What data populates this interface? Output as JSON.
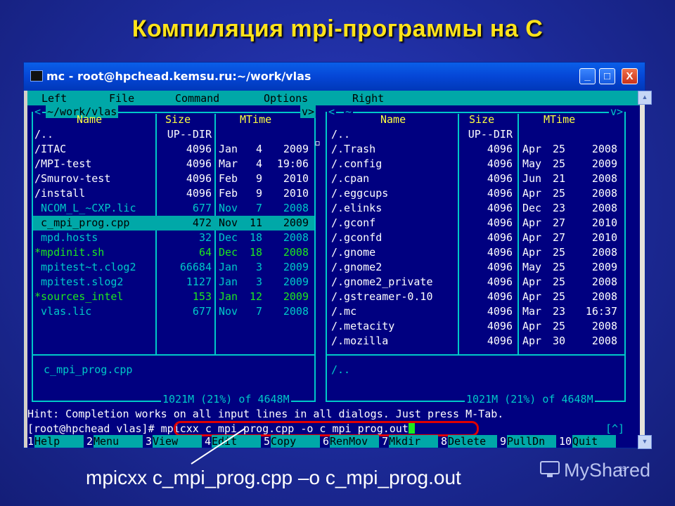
{
  "slide": {
    "title": "Компиляция mpi-программы на С",
    "caption": "mpicxx c_mpi_prog.cpp –o c_mpi_prog.out",
    "watermark": "MyShared",
    "slide_number": "25"
  },
  "window": {
    "title": "mc - root@hpchead.kemsu.ru:~/work/vlas",
    "buttons": {
      "minimize": "_",
      "maximize": "□",
      "close": "X"
    }
  },
  "menu": [
    "Left",
    "File",
    "Command",
    "Options",
    "Right"
  ],
  "left_panel": {
    "path": "~/work/vlas",
    "nav_left": "<",
    "nav_right": "v>",
    "headers": {
      "name": "Name",
      "size": "Size",
      "mtime": "MTime"
    },
    "rows": [
      {
        "name": "/..",
        "size": "UP--DIR",
        "month": "",
        "day": "",
        "time": "",
        "style": "white"
      },
      {
        "name": "/ITAC",
        "size": "4096",
        "month": "Jan",
        "day": "4",
        "time": "2009",
        "style": "white"
      },
      {
        "name": "/MPI-test",
        "size": "4096",
        "month": "Mar",
        "day": "4",
        "time": "19:06",
        "style": "white"
      },
      {
        "name": "/Smurov-test",
        "size": "4096",
        "month": "Feb",
        "day": "9",
        "time": "2010",
        "style": "white"
      },
      {
        "name": "/install",
        "size": "4096",
        "month": "Feb",
        "day": "9",
        "time": "2010",
        "style": "white"
      },
      {
        "name": " NCOM_L_~CXP.lic",
        "size": "677",
        "month": "Nov",
        "day": "7",
        "time": "2008",
        "style": "cyan"
      },
      {
        "name": " c_mpi_prog.cpp",
        "size": "472",
        "month": "Nov",
        "day": "11",
        "time": "2009",
        "style": "selected"
      },
      {
        "name": " mpd.hosts",
        "size": "32",
        "month": "Dec",
        "day": "18",
        "time": "2008",
        "style": "cyan"
      },
      {
        "name": "*mpdinit.sh",
        "size": "64",
        "month": "Dec",
        "day": "18",
        "time": "2008",
        "style": "green"
      },
      {
        "name": " mpitest~t.clog2",
        "size": "66684",
        "month": "Jan",
        "day": "3",
        "time": "2009",
        "style": "cyan"
      },
      {
        "name": " mpitest.slog2",
        "size": "1127",
        "month": "Jan",
        "day": "3",
        "time": "2009",
        "style": "cyan"
      },
      {
        "name": "*sources_intel",
        "size": "153",
        "month": "Jan",
        "day": "12",
        "time": "2009",
        "style": "green"
      },
      {
        "name": " vlas.lic",
        "size": "677",
        "month": "Nov",
        "day": "7",
        "time": "2008",
        "style": "cyan"
      }
    ],
    "status_name": " c_mpi_prog.cpp",
    "disk_info": "1021M (21%) of 4648M"
  },
  "right_panel": {
    "path": "~",
    "nav_left": "<",
    "nav_right": "v>",
    "headers": {
      "name": "Name",
      "size": "Size",
      "mtime": "MTime"
    },
    "rows": [
      {
        "name": "/..",
        "size": "UP--DIR",
        "month": "",
        "day": "",
        "time": "",
        "style": "white"
      },
      {
        "name": "/.Trash",
        "size": "4096",
        "month": "Apr",
        "day": "25",
        "time": "2008",
        "style": "white"
      },
      {
        "name": "/.config",
        "size": "4096",
        "month": "May",
        "day": "25",
        "time": "2009",
        "style": "white"
      },
      {
        "name": "/.cpan",
        "size": "4096",
        "month": "Jun",
        "day": "21",
        "time": "2008",
        "style": "white"
      },
      {
        "name": "/.eggcups",
        "size": "4096",
        "month": "Apr",
        "day": "25",
        "time": "2008",
        "style": "white"
      },
      {
        "name": "/.elinks",
        "size": "4096",
        "month": "Dec",
        "day": "23",
        "time": "2008",
        "style": "white"
      },
      {
        "name": "/.gconf",
        "size": "4096",
        "month": "Apr",
        "day": "27",
        "time": "2010",
        "style": "white"
      },
      {
        "name": "/.gconfd",
        "size": "4096",
        "month": "Apr",
        "day": "27",
        "time": "2010",
        "style": "white"
      },
      {
        "name": "/.gnome",
        "size": "4096",
        "month": "Apr",
        "day": "25",
        "time": "2008",
        "style": "white"
      },
      {
        "name": "/.gnome2",
        "size": "4096",
        "month": "May",
        "day": "25",
        "time": "2009",
        "style": "white"
      },
      {
        "name": "/.gnome2_private",
        "size": "4096",
        "month": "Apr",
        "day": "25",
        "time": "2008",
        "style": "white"
      },
      {
        "name": "/.gstreamer-0.10",
        "size": "4096",
        "month": "Apr",
        "day": "25",
        "time": "2008",
        "style": "white"
      },
      {
        "name": "/.mc",
        "size": "4096",
        "month": "Mar",
        "day": "23",
        "time": "16:37",
        "style": "white"
      },
      {
        "name": "/.metacity",
        "size": "4096",
        "month": "Apr",
        "day": "25",
        "time": "2008",
        "style": "white"
      },
      {
        "name": "/.mozilla",
        "size": "4096",
        "month": "Apr",
        "day": "30",
        "time": "2008",
        "style": "white"
      }
    ],
    "status_name": "/..",
    "disk_info": "1021M (21%) of 4648M"
  },
  "hint": "Hint: Completion works on all input lines in all dialogs. Just press M-Tab.",
  "prompt": "[root@hpchead vlas]#",
  "command": " mpicxx c_mpi_prog.cpp -o c_mpi_prog.out",
  "scroll_hint": "[^]",
  "fkeys": [
    {
      "num": "1",
      "label": "Help"
    },
    {
      "num": "2",
      "label": "Menu"
    },
    {
      "num": "3",
      "label": "View"
    },
    {
      "num": "4",
      "label": "Edit"
    },
    {
      "num": "5",
      "label": "Copy"
    },
    {
      "num": "6",
      "label": "RenMov"
    },
    {
      "num": "7",
      "label": "Mkdir"
    },
    {
      "num": "8",
      "label": "Delete"
    },
    {
      "num": "9",
      "label": "PullDn"
    },
    {
      "num": "10",
      "label": "Quit"
    }
  ],
  "colors": {
    "cyan": "#00c8c8",
    "green": "#1ee81e",
    "white": "#ffffff",
    "selected_bg": "#00a8a8",
    "terminal_bg": "#000080",
    "title_yellow": "#ffe31a"
  }
}
